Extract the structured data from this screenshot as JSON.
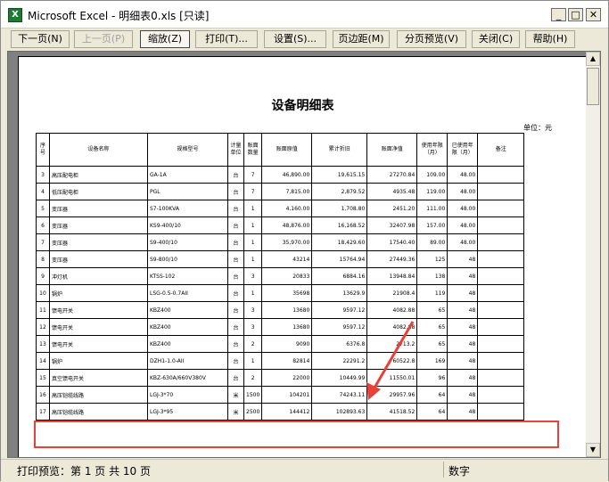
{
  "window": {
    "title": "Microsoft Excel - 明细表0.xls  [只读]"
  },
  "toolbar": {
    "next": "下一页(N)",
    "prev": "上一页(P)",
    "zoom": "缩放(Z)",
    "print": "打印(T)...",
    "setup": "设置(S)...",
    "margins": "页边距(M)",
    "page_break": "分页预览(V)",
    "close": "关闭(C)",
    "help": "帮助(H)"
  },
  "sheet": {
    "title": "设备明细表",
    "unit": "单位：元",
    "headers": [
      "序号",
      "设备名称",
      "规格型号",
      "计量单位",
      "账面数量",
      "账面原值",
      "累计折旧",
      "账面净值",
      "使用年限（月）",
      "已使用年限（月）",
      "备注"
    ],
    "rows": [
      [
        "3",
        "高压配电柜",
        "GA-1A",
        "台",
        "7",
        "46,890.00",
        "19,615.15",
        "27270.84",
        "109.00",
        "48.00",
        ""
      ],
      [
        "4",
        "低压配电柜",
        "PGL",
        "台",
        "7",
        "7,815.00",
        "2,879.52",
        "4935.48",
        "119.00",
        "48.00",
        ""
      ],
      [
        "5",
        "变压器",
        "S7-100KVA",
        "台",
        "1",
        "4,160.00",
        "1,708.80",
        "2451.20",
        "111.00",
        "48.00",
        ""
      ],
      [
        "6",
        "变压器",
        "KS9-400/10",
        "台",
        "1",
        "48,876.00",
        "16,168.52",
        "32407.98",
        "157.00",
        "48.00",
        ""
      ],
      [
        "7",
        "变压器",
        "S9-400/10",
        "台",
        "1",
        "35,970.00",
        "18,429.60",
        "17540.40",
        "89.00",
        "48.00",
        ""
      ],
      [
        "8",
        "变压器",
        "S9-800/10",
        "台",
        "1",
        "43214",
        "15764.94",
        "27449.36",
        "125",
        "48",
        ""
      ],
      [
        "9",
        "冲灯机",
        "KTSS-102",
        "台",
        "3",
        "20833",
        "6884.16",
        "13948.84",
        "138",
        "48",
        ""
      ],
      [
        "10",
        "锅炉",
        "LSG-0.5-0.7AII",
        "台",
        "1",
        "35698",
        "13629.9",
        "21908.4",
        "119",
        "48",
        ""
      ],
      [
        "11",
        "馈电开关",
        "KBZ400",
        "台",
        "3",
        "13680",
        "9597.12",
        "4082.88",
        "65",
        "48",
        ""
      ],
      [
        "12",
        "馈电开关",
        "KBZ400",
        "台",
        "3",
        "13680",
        "9597.12",
        "4082.88",
        "65",
        "48",
        ""
      ],
      [
        "13",
        "馈电开关",
        "KBZ400",
        "台",
        "2",
        "9090",
        "6376.8",
        "2713.2",
        "65",
        "48",
        ""
      ],
      [
        "14",
        "锅炉",
        "DZH1-1.0-AII",
        "台",
        "1",
        "82814",
        "22291.2",
        "60522.8",
        "169",
        "48",
        ""
      ],
      [
        "15",
        "真空馈电开关",
        "KBZ-630A/660V380V",
        "台",
        "2",
        "22000",
        "10449.99",
        "11550.01",
        "96",
        "48",
        ""
      ],
      [
        "16",
        "高压铠缆线路",
        "LGJ-3*70",
        "米",
        "1500",
        "104201",
        "74243.11",
        "29957.96",
        "64",
        "48",
        ""
      ],
      [
        "17",
        "高压铠缆线路",
        "LGJ-3*95",
        "米",
        "2500",
        "144412",
        "102893.63",
        "41518.52",
        "64",
        "48",
        ""
      ]
    ]
  },
  "status": {
    "left": "打印预览：第 1 页  共 10 页",
    "right": "数字"
  }
}
